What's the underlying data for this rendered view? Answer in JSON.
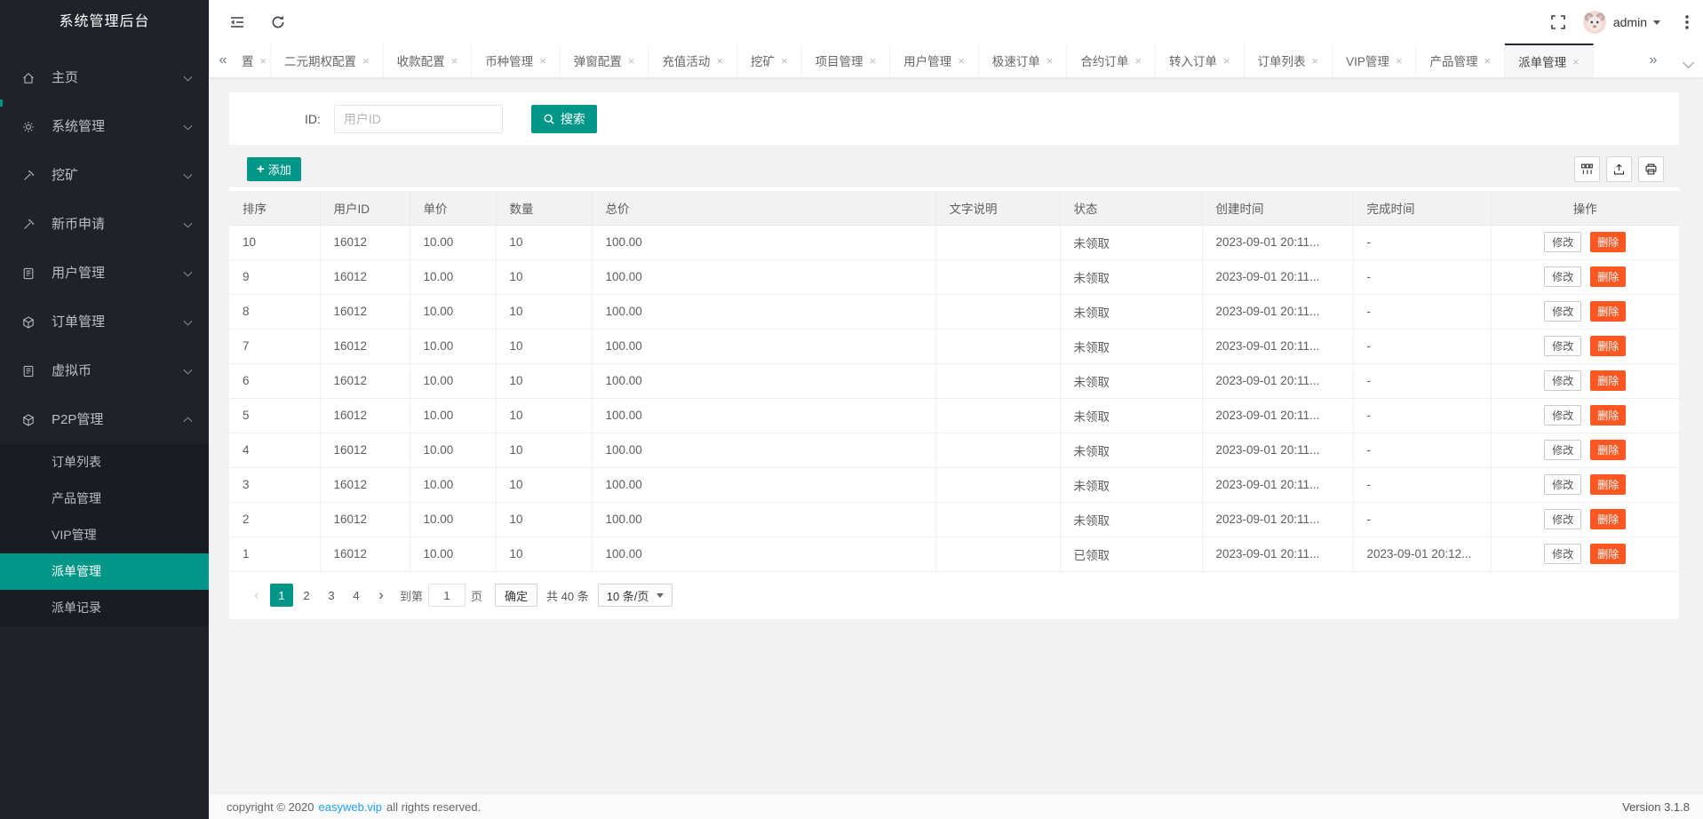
{
  "colors": {
    "accent": "#009688",
    "danger": "#FF5722",
    "link": "#1E9FFF",
    "sidebar_bg": "#20222A"
  },
  "icons": {
    "tab-scroll-left": "«",
    "tab-scroll-right": "»",
    "tab-close": "×",
    "page-prev": "‹",
    "page-next": "›",
    "add-plus": "+"
  },
  "sidebar": {
    "title": "系统管理后台",
    "menu": [
      {
        "label": "主页",
        "icon": "home-icon",
        "expanded": false
      },
      {
        "label": "系统管理",
        "icon": "gear-icon",
        "expanded": false
      },
      {
        "label": "挖矿",
        "icon": "mining-icon",
        "expanded": false
      },
      {
        "label": "新币申请",
        "icon": "new-coin-icon",
        "expanded": false
      },
      {
        "label": "用户管理",
        "icon": "users-icon",
        "expanded": false
      },
      {
        "label": "订单管理",
        "icon": "orders-icon",
        "expanded": false
      },
      {
        "label": "虚拟币",
        "icon": "virtual-coin-icon",
        "expanded": false
      },
      {
        "label": "P2P管理",
        "icon": "p2p-icon",
        "expanded": true
      }
    ],
    "submenu": [
      {
        "label": "订单列表",
        "active": false
      },
      {
        "label": "产品管理",
        "active": false
      },
      {
        "label": "VIP管理",
        "active": false
      },
      {
        "label": "派单管理",
        "active": true
      },
      {
        "label": "派单记录",
        "active": false
      }
    ]
  },
  "header": {
    "username": "admin"
  },
  "tabs": [
    {
      "label": "置",
      "partial": true,
      "active": false
    },
    {
      "label": "二元期权配置",
      "active": false
    },
    {
      "label": "收款配置",
      "active": false
    },
    {
      "label": "币种管理",
      "active": false
    },
    {
      "label": "弹窗配置",
      "active": false
    },
    {
      "label": "充值活动",
      "active": false
    },
    {
      "label": "挖矿",
      "active": false
    },
    {
      "label": "项目管理",
      "active": false
    },
    {
      "label": "用户管理",
      "active": false
    },
    {
      "label": "极速订单",
      "active": false
    },
    {
      "label": "合约订单",
      "active": false
    },
    {
      "label": "转入订单",
      "active": false
    },
    {
      "label": "订单列表",
      "active": false
    },
    {
      "label": "VIP管理",
      "active": false
    },
    {
      "label": "产品管理",
      "active": false
    },
    {
      "label": "派单管理",
      "active": true
    }
  ],
  "search": {
    "label": "ID:",
    "placeholder": "用户ID",
    "value": "",
    "button": "搜索"
  },
  "toolbar": {
    "add_label": "添加"
  },
  "table": {
    "columns": [
      "排序",
      "用户ID",
      "单价",
      "数量",
      "总价",
      "文字说明",
      "状态",
      "创建时间",
      "完成时间",
      "操作"
    ],
    "actions": {
      "edit": "修改",
      "delete": "删除"
    },
    "rows": [
      {
        "sort": "10",
        "uid": "16012",
        "price": "10.00",
        "qty": "10",
        "total": "100.00",
        "desc": "",
        "status": "未领取",
        "created": "2023-09-01 20:11...",
        "finished": "-"
      },
      {
        "sort": "9",
        "uid": "16012",
        "price": "10.00",
        "qty": "10",
        "total": "100.00",
        "desc": "",
        "status": "未领取",
        "created": "2023-09-01 20:11...",
        "finished": "-"
      },
      {
        "sort": "8",
        "uid": "16012",
        "price": "10.00",
        "qty": "10",
        "total": "100.00",
        "desc": "",
        "status": "未领取",
        "created": "2023-09-01 20:11...",
        "finished": "-"
      },
      {
        "sort": "7",
        "uid": "16012",
        "price": "10.00",
        "qty": "10",
        "total": "100.00",
        "desc": "",
        "status": "未领取",
        "created": "2023-09-01 20:11...",
        "finished": "-"
      },
      {
        "sort": "6",
        "uid": "16012",
        "price": "10.00",
        "qty": "10",
        "total": "100.00",
        "desc": "",
        "status": "未领取",
        "created": "2023-09-01 20:11...",
        "finished": "-"
      },
      {
        "sort": "5",
        "uid": "16012",
        "price": "10.00",
        "qty": "10",
        "total": "100.00",
        "desc": "",
        "status": "未领取",
        "created": "2023-09-01 20:11...",
        "finished": "-"
      },
      {
        "sort": "4",
        "uid": "16012",
        "price": "10.00",
        "qty": "10",
        "total": "100.00",
        "desc": "",
        "status": "未领取",
        "created": "2023-09-01 20:11...",
        "finished": "-"
      },
      {
        "sort": "3",
        "uid": "16012",
        "price": "10.00",
        "qty": "10",
        "total": "100.00",
        "desc": "",
        "status": "未领取",
        "created": "2023-09-01 20:11...",
        "finished": "-"
      },
      {
        "sort": "2",
        "uid": "16012",
        "price": "10.00",
        "qty": "10",
        "total": "100.00",
        "desc": "",
        "status": "未领取",
        "created": "2023-09-01 20:11...",
        "finished": "-"
      },
      {
        "sort": "1",
        "uid": "16012",
        "price": "10.00",
        "qty": "10",
        "total": "100.00",
        "desc": "",
        "status": "已领取",
        "created": "2023-09-01 20:11...",
        "finished": "2023-09-01 20:12..."
      }
    ]
  },
  "pagination": {
    "pages": [
      "1",
      "2",
      "3",
      "4"
    ],
    "active": "1",
    "jump_prefix": "到第",
    "jump_value": "1",
    "jump_suffix": "页",
    "confirm": "确定",
    "total": "共 40 条",
    "page_size": "10 条/页"
  },
  "footer": {
    "copyright_prefix": "copyright © 2020",
    "link": "easyweb.vip",
    "copyright_suffix": "all rights reserved.",
    "version": "Version 3.1.8"
  }
}
